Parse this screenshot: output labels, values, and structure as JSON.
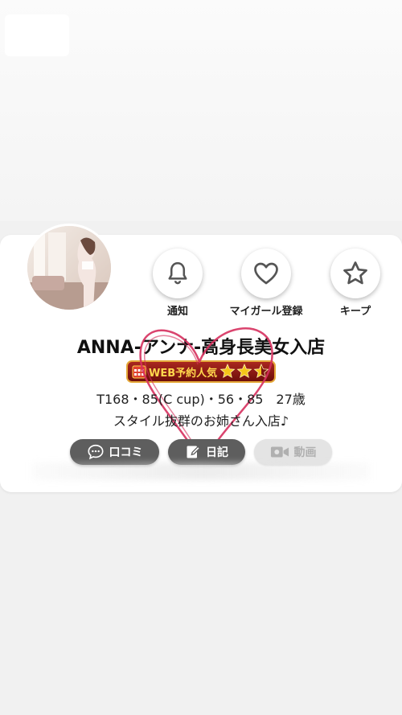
{
  "profile": {
    "name": "ANNA-アンナ-高身長美女入店",
    "badge_text": "WEB予約人気",
    "badge_stars": 2.5,
    "stats": "T168・85(C cup)・56・85　27歳",
    "description": "スタイル抜群のお姉さん入店♪"
  },
  "actions": {
    "notify_label": "通知",
    "mygirl_label": "マイガール登録",
    "keep_label": "キープ"
  },
  "buttons": {
    "review_label": "口コミ",
    "diary_label": "日記",
    "video_label": "動画"
  },
  "colors": {
    "heart_overlay": "#d6305e",
    "badge_bg": "#8e1a14",
    "badge_text": "#ffd84d",
    "star": "#f5c518",
    "pill_bg": "#5e5e5e"
  },
  "icons": [
    "bell-icon",
    "heart-icon",
    "star-icon",
    "chat-icon",
    "edit-icon",
    "video-icon",
    "calendar-icon"
  ]
}
